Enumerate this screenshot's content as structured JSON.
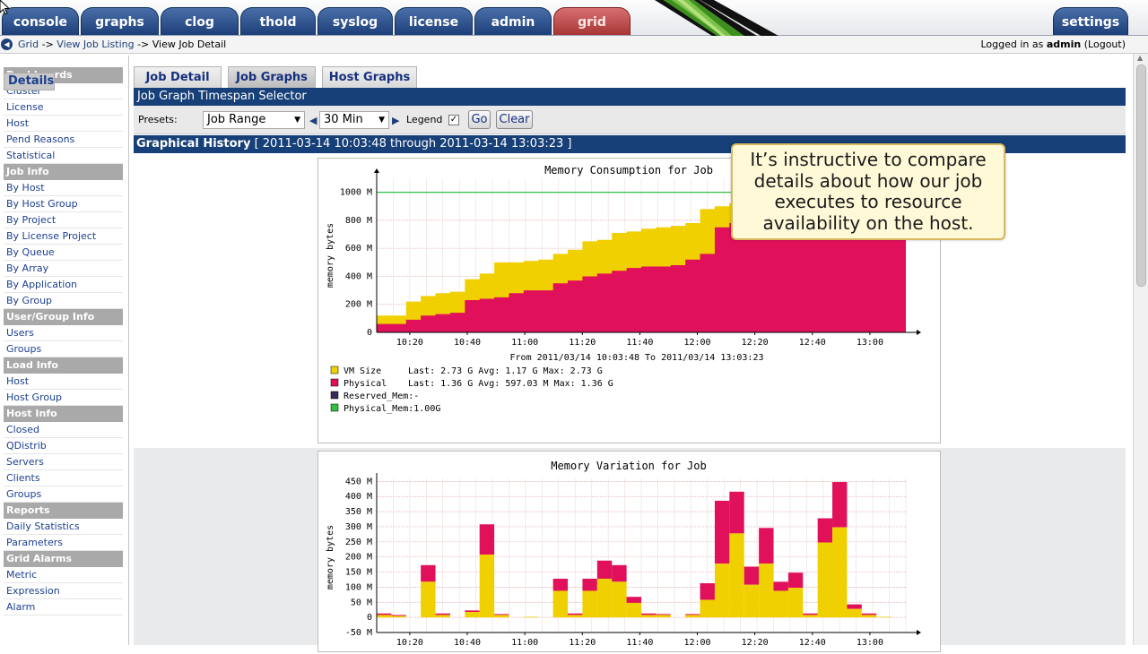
{
  "nav": {
    "tabs": [
      "console",
      "graphs",
      "clog",
      "thold",
      "syslog",
      "license",
      "admin",
      "grid"
    ],
    "settings": "settings"
  },
  "breadcrumb": {
    "grid": "Grid",
    "listing": "View Job Listing",
    "current": "View Job Detail",
    "sep": "->",
    "logged_prefix": "Logged in as",
    "user": "admin",
    "logout": "(Logout)"
  },
  "sidebar": {
    "sections": [
      {
        "header": "Dashboards",
        "items": [
          "Cluster",
          "License",
          "Host",
          "Pend Reasons",
          "Statistical"
        ]
      },
      {
        "header": "Job Info",
        "items": [
          "By Host",
          "By Host Group",
          "By Project",
          "By License Project",
          "By Queue",
          "By Array",
          "By Application",
          "By Group",
          "Details"
        ]
      },
      {
        "header": "User/Group Info",
        "items": [
          "Users",
          "Groups"
        ]
      },
      {
        "header": "Load Info",
        "items": [
          "Host",
          "Host Group"
        ]
      },
      {
        "header": "Host Info",
        "items": [
          "Closed",
          "QDistrib",
          "Servers",
          "Clients",
          "Groups"
        ]
      },
      {
        "header": "Reports",
        "items": [
          "Daily Statistics",
          "Parameters"
        ]
      },
      {
        "header": "Grid Alarms",
        "items": [
          "Metric",
          "Expression",
          "Alarm"
        ]
      }
    ],
    "selected": "Details"
  },
  "subtabs": [
    "Job Detail",
    "Job Graphs",
    "Host Graphs"
  ],
  "selector": {
    "title": "Job Graph Timespan Selector",
    "presets_label": "Presets:",
    "preset_value": "Job Range",
    "span_value": "30 Min",
    "legend_label": "Legend",
    "legend_checked": "✓",
    "go": "Go",
    "clear": "Clear"
  },
  "history": {
    "label": "Graphical History",
    "range": "[ 2011-03-14 10:03:48 through 2011-03-14 13:03:23 ]"
  },
  "callout": "It’s instructive to compare details about how our job executes to resource availability on the host.",
  "colors": {
    "vmsize": "#f0d000",
    "physical": "#e0105a",
    "reserved": "#3a2a5a",
    "physmem": "#30c040",
    "nav_tab": "#1d3f7a",
    "nav_tab_active": "#a83535",
    "section_header": "#173f78"
  },
  "chart_data": [
    {
      "type": "area",
      "title": "Memory Consumption for Job",
      "ylabel": "memory bytes",
      "xlabel": "From 2011/03/14 10:03:48 To 2011/03/14 13:03:23",
      "x": [
        "10:04",
        "10:10",
        "10:15",
        "10:20",
        "10:25",
        "10:30",
        "10:35",
        "10:40",
        "10:45",
        "10:50",
        "10:55",
        "11:00",
        "11:05",
        "11:10",
        "11:15",
        "11:20",
        "11:25",
        "11:30",
        "11:35",
        "11:40",
        "11:45",
        "11:50",
        "11:55",
        "12:00",
        "12:05",
        "12:10",
        "12:15",
        "12:20",
        "12:25",
        "12:30",
        "12:35",
        "12:40",
        "12:45",
        "12:50",
        "12:55",
        "13:03"
      ],
      "xticks": [
        "10:20",
        "10:40",
        "11:00",
        "11:20",
        "11:40",
        "12:00",
        "12:20",
        "12:40",
        "13:00"
      ],
      "yticks": [
        "0",
        "200 M",
        "400 M",
        "600 M",
        "800 M",
        "1000 M"
      ],
      "ylim": [
        0,
        1100
      ],
      "series": [
        {
          "name": "VM Size",
          "values": [
            120,
            120,
            220,
            260,
            280,
            290,
            380,
            420,
            500,
            500,
            510,
            520,
            560,
            590,
            650,
            660,
            710,
            720,
            740,
            750,
            760,
            780,
            880,
            900,
            920,
            940,
            960,
            970,
            980,
            990,
            1000,
            1020,
            1040,
            1050,
            1060,
            1060
          ]
        },
        {
          "name": "Physical",
          "values": [
            60,
            60,
            90,
            120,
            130,
            140,
            230,
            240,
            250,
            280,
            300,
            300,
            350,
            370,
            400,
            420,
            440,
            460,
            470,
            470,
            480,
            520,
            560,
            750,
            780,
            800,
            820,
            840,
            860,
            880,
            900,
            920,
            930,
            930,
            940,
            940
          ]
        }
      ],
      "legend": [
        {
          "label": "VM Size",
          "text": "Last:    2.73 G  Avg:    1.17 G  Max:    2.73 G"
        },
        {
          "label": "Physical",
          "text": "Last:    1.36 G  Avg:  597.03 M  Max:    1.36 G"
        },
        {
          "label": "Reserved_Mem:-",
          "text": ""
        },
        {
          "label": "Physical_Mem:1.00G",
          "text": ""
        }
      ],
      "reference_line": {
        "name": "Physical_Mem",
        "value": 1000
      }
    },
    {
      "type": "bar",
      "title": "Memory Variation for Job",
      "ylabel": "memory bytes",
      "xticks": [
        "10:20",
        "10:40",
        "11:00",
        "11:20",
        "11:40",
        "12:00",
        "12:20",
        "12:40",
        "13:00"
      ],
      "yticks": [
        "-50 M",
        "0",
        "50 M",
        "100 M",
        "150 M",
        "200 M",
        "250 M",
        "300 M",
        "350 M",
        "400 M",
        "450 M"
      ],
      "ylim": [
        -50,
        460
      ],
      "series": [
        {
          "name": "VM Size",
          "values": [
            8,
            5,
            0,
            118,
            8,
            0,
            18,
            208,
            8,
            0,
            2,
            0,
            88,
            8,
            88,
            128,
            118,
            48,
            8,
            8,
            0,
            8,
            58,
            178,
            278,
            108,
            178,
            88,
            98,
            8,
            248,
            298,
            28,
            8,
            2,
            0
          ]
        },
        {
          "name": "Physical",
          "values": [
            5,
            3,
            0,
            55,
            5,
            0,
            5,
            100,
            3,
            0,
            0,
            0,
            40,
            5,
            40,
            60,
            55,
            20,
            5,
            3,
            0,
            3,
            55,
            208,
            138,
            60,
            118,
            30,
            50,
            5,
            80,
            150,
            15,
            5,
            0,
            0
          ]
        }
      ]
    }
  ]
}
